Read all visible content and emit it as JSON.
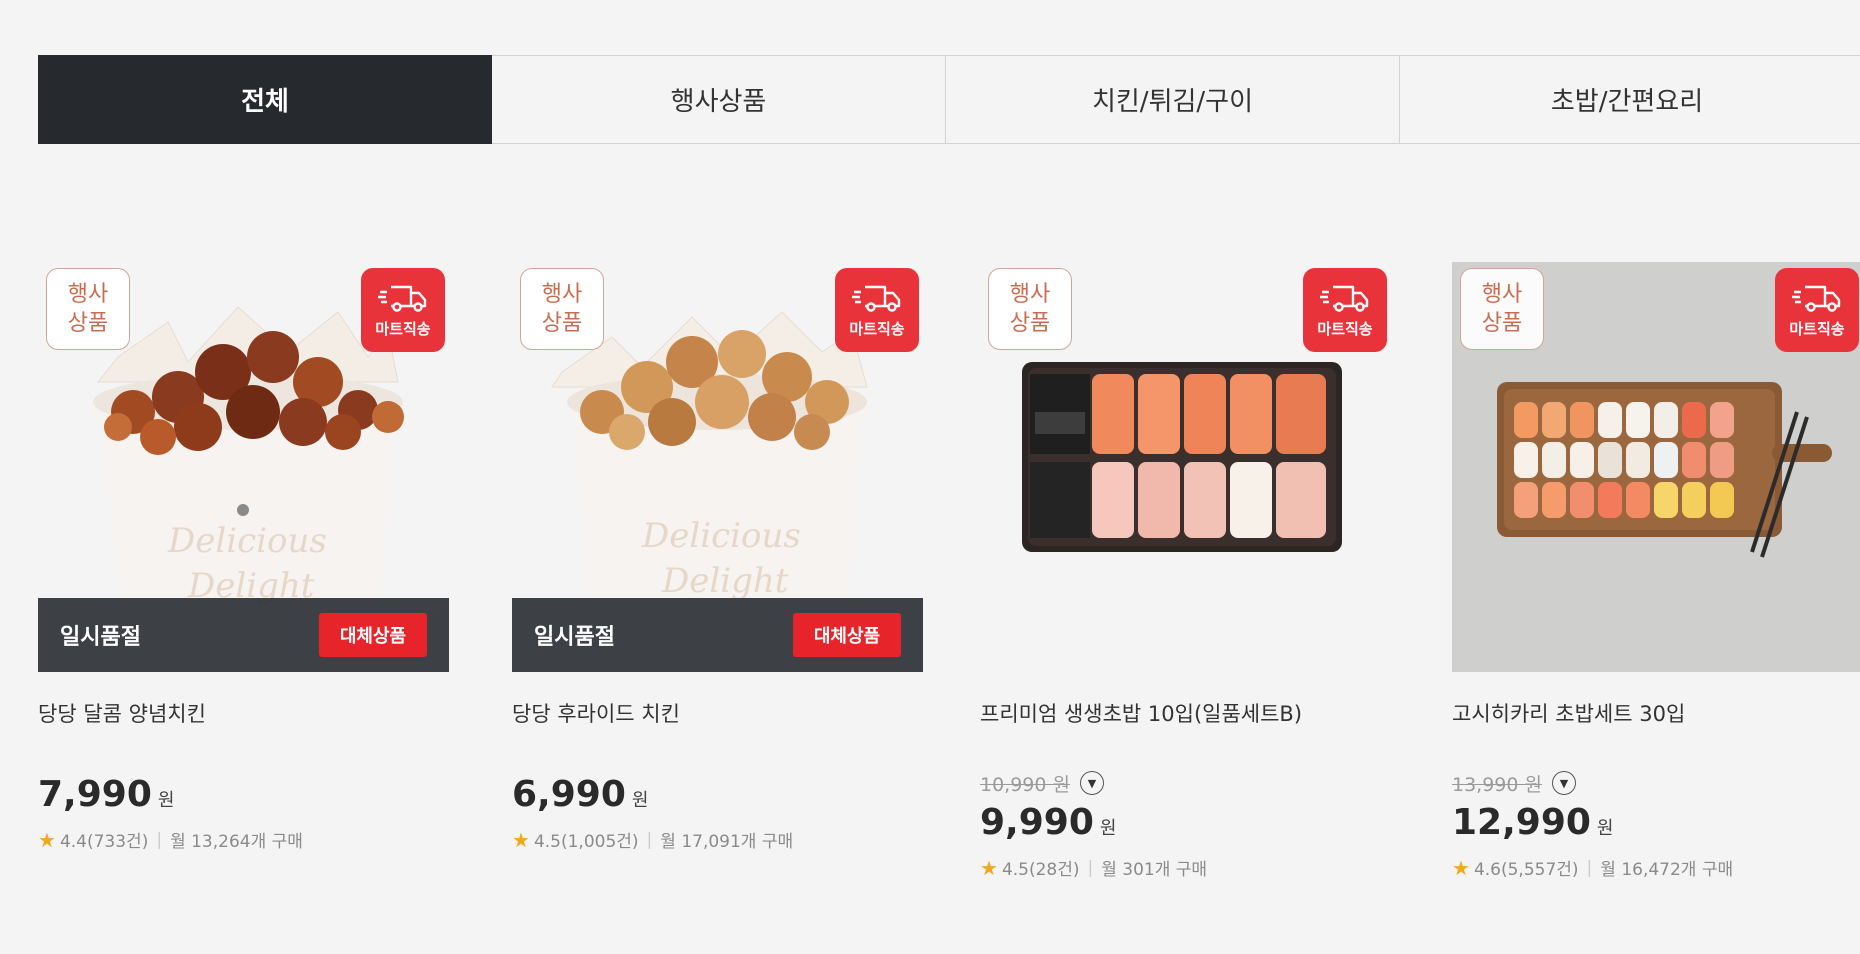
{
  "tabs": [
    {
      "label": "전체",
      "active": true
    },
    {
      "label": "행사상품",
      "active": false
    },
    {
      "label": "치킨/튀김/구이",
      "active": false
    },
    {
      "label": "초밥/간편요리",
      "active": false
    }
  ],
  "badges": {
    "event_line1": "행사",
    "event_line2": "상품",
    "delivery": "마트직송",
    "soldout": "일시품절",
    "alternative": "대체상품"
  },
  "products": [
    {
      "name": "당당 달콤 양념치킨",
      "price": "7,990",
      "won": "원",
      "rating": "4.4(733건)",
      "monthly": "월 13,264개 구매"
    },
    {
      "name": "당당 후라이드 치킨",
      "price": "6,990",
      "won": "원",
      "rating": "4.5(1,005건)",
      "monthly": "월 17,091개 구매"
    },
    {
      "name": "프리미엄 생생초밥 10입(일품세트B)",
      "original_price": "10,990 원",
      "price": "9,990",
      "won": "원",
      "rating": "4.5(28건)",
      "monthly": "월 301개 구매"
    },
    {
      "name": "고시히카리 초밥세트 30입",
      "original_price": "13,990 원",
      "price": "12,990",
      "won": "원",
      "rating": "4.6(5,557건)",
      "monthly": "월 16,472개 구매"
    }
  ],
  "colors": {
    "accent_red": "#e8333a",
    "tab_active_bg": "#262a2e",
    "star": "#f0a91f"
  }
}
